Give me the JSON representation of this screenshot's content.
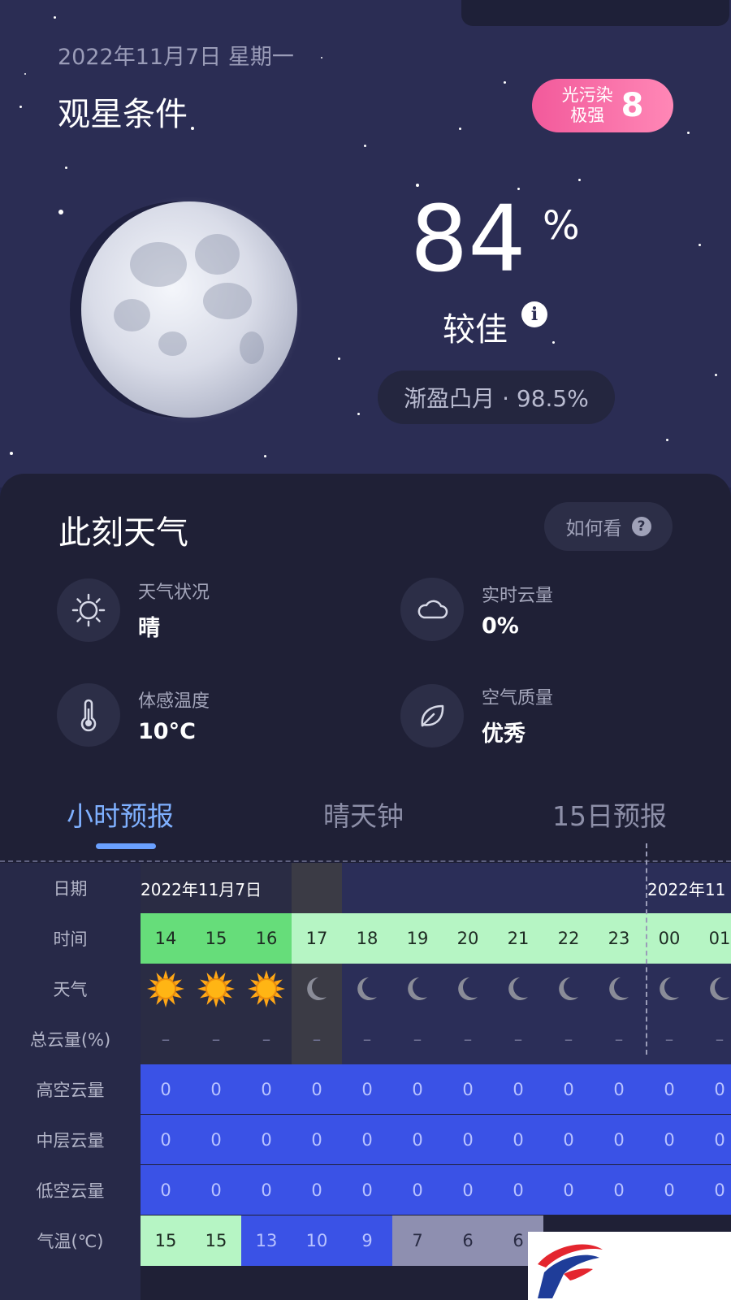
{
  "header": {
    "date_line": "2022年11月7日  星期一",
    "title": "观星条件",
    "light_pollution": {
      "label_line1": "光污染",
      "label_line2": "极强",
      "level": "8"
    }
  },
  "score": {
    "value": "84",
    "unit": "%",
    "rating": "较佳",
    "info_icon": "i"
  },
  "moon": {
    "phase_text": "渐盈凸月 · 98.5%"
  },
  "weather_now": {
    "title": "此刻天气",
    "help_button": "如何看",
    "help_icon": "?",
    "stats": [
      {
        "icon": "sun-icon",
        "label": "天气状况",
        "value": "晴"
      },
      {
        "icon": "cloud-icon",
        "label": "实时云量",
        "value": "0%"
      },
      {
        "icon": "thermometer-icon",
        "label": "体感温度",
        "value": "10°C"
      },
      {
        "icon": "leaf-icon",
        "label": "空气质量",
        "value": "优秀"
      }
    ]
  },
  "tabs": [
    "小时预报",
    "晴天钟",
    "15日预报"
  ],
  "active_tab": 0,
  "forecast": {
    "row_labels": [
      "日期",
      "时间",
      "天气",
      "总云量(%)",
      "高空云量",
      "中层云量",
      "低空云量",
      "气温(℃)"
    ],
    "dates": [
      "2022年11月7日",
      "2022年11"
    ],
    "hours": [
      "14",
      "15",
      "16",
      "17",
      "18",
      "19",
      "20",
      "21",
      "22",
      "23",
      "00",
      "01"
    ],
    "weather_icons": [
      "sun-icon",
      "sun-icon",
      "sun-icon",
      "moon-icon",
      "moon-icon",
      "moon-icon",
      "moon-icon",
      "moon-icon",
      "moon-icon",
      "moon-icon",
      "moon-icon",
      "moon-icon"
    ],
    "total_cloud": [
      "–",
      "–",
      "–",
      "–",
      "–",
      "–",
      "–",
      "–",
      "–",
      "–",
      "–",
      "–"
    ],
    "high_cloud": [
      "0",
      "0",
      "0",
      "0",
      "0",
      "0",
      "0",
      "0",
      "0",
      "0",
      "0",
      "0"
    ],
    "mid_cloud": [
      "0",
      "0",
      "0",
      "0",
      "0",
      "0",
      "0",
      "0",
      "0",
      "0",
      "0",
      "0"
    ],
    "low_cloud": [
      "0",
      "0",
      "0",
      "0",
      "0",
      "0",
      "0",
      "0",
      "0",
      "0",
      "0",
      "0"
    ],
    "temperature": [
      "15",
      "15",
      "13",
      "10",
      "9",
      "7",
      "6",
      "6"
    ]
  },
  "colors": {
    "accent_blue": "#7fb0ff",
    "cloud_blue": "#3a52e6",
    "hour_day_green": "#66dd7a",
    "hour_night_green": "#b6f5c4",
    "badge_pink": "#f25a9b"
  }
}
